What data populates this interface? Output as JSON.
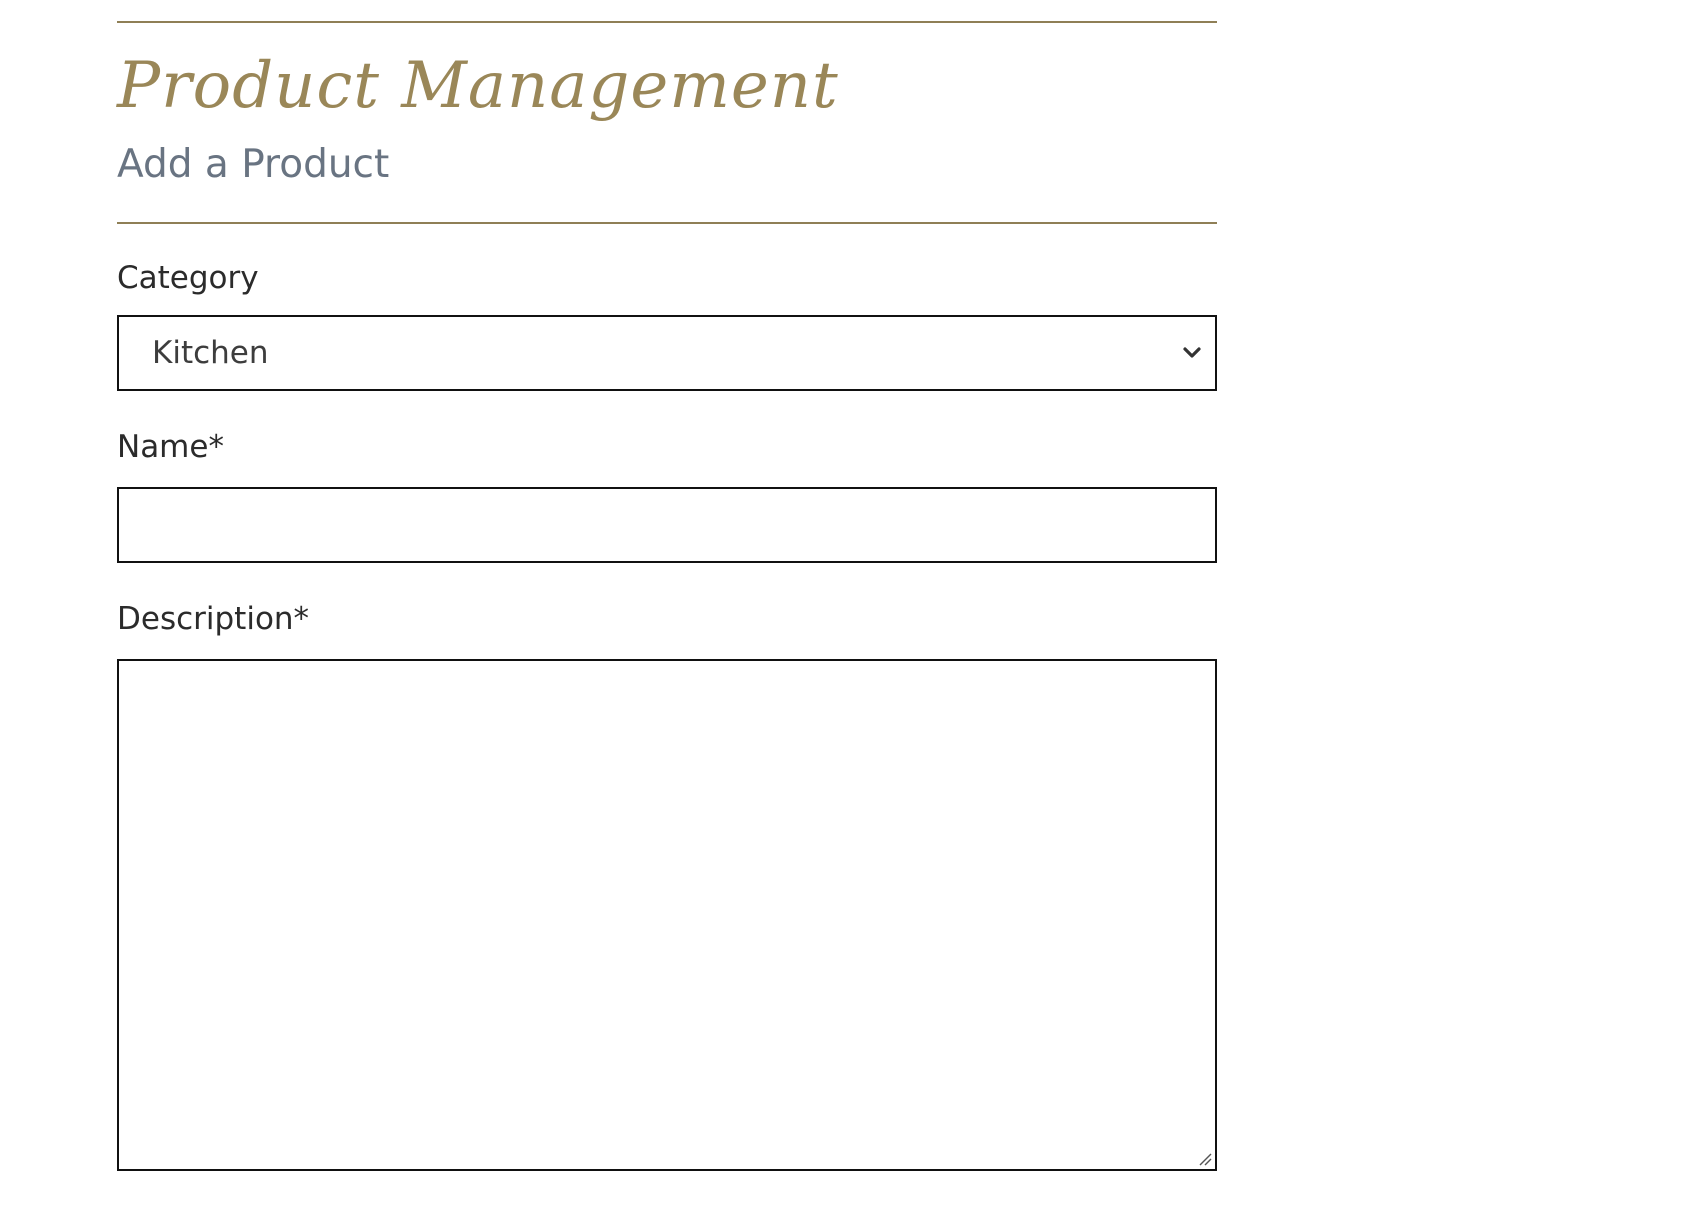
{
  "header": {
    "title": "Product Management",
    "subtitle": "Add a Product"
  },
  "form": {
    "category": {
      "label": "Category",
      "selected": "Kitchen"
    },
    "name": {
      "label": "Name*",
      "value": ""
    },
    "description": {
      "label": "Description*",
      "value": ""
    }
  },
  "icons": {
    "select_arrow": "chevron-down-icon",
    "textarea_resize": "resize-grip-icon"
  },
  "colors": {
    "accent": "#9a8758",
    "subtitle": "#697482",
    "divider": "#8f7f56",
    "border": "#111111"
  }
}
